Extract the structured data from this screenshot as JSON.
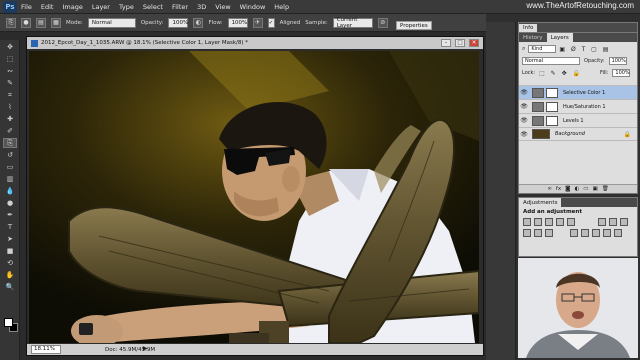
{
  "menubar": {
    "logo": "Ps",
    "items": [
      "File",
      "Edit",
      "Image",
      "Layer",
      "Type",
      "Select",
      "Filter",
      "3D",
      "View",
      "Window",
      "Help"
    ],
    "watermark": "www.TheArtofRetouching.com"
  },
  "options": {
    "mode_label": "Mode:",
    "mode_value": "Normal",
    "opacity_label": "Opacity:",
    "opacity_value": "100%",
    "flow_label": "Flow:",
    "flow_value": "100%",
    "aligned_label": "Aligned",
    "sample_label": "Sample:",
    "sample_value": "Current Layer",
    "properties_label": "Properties"
  },
  "document": {
    "title": "2012_Epcot_Day_1_1035.ARW @ 18.1% (Selective Color 1, Layer Mask/8) *",
    "zoom": "18.11%",
    "doc_info": "Doc: 45.9M/45.9M"
  },
  "panels": {
    "info_tab": "Info",
    "history_tab": "History",
    "layers_tab": "Layers",
    "kind_label": "Kind",
    "blend_mode": "Normal",
    "opacity_label": "Opacity:",
    "opacity_value": "100%",
    "lock_label": "Lock:",
    "fill_label": "Fill:",
    "fill_value": "100%",
    "layers": [
      {
        "name": "Selective Color 1",
        "selected": true
      },
      {
        "name": "Hue/Saturation 1",
        "selected": false
      },
      {
        "name": "Levels 1",
        "selected": false
      },
      {
        "name": "Background",
        "selected": false
      }
    ],
    "adjustments_tab": "Adjustments",
    "add_adjustment": "Add an adjustment"
  },
  "colors": {
    "selection": "#a8c3e6",
    "panel_bg": "#dedede"
  }
}
